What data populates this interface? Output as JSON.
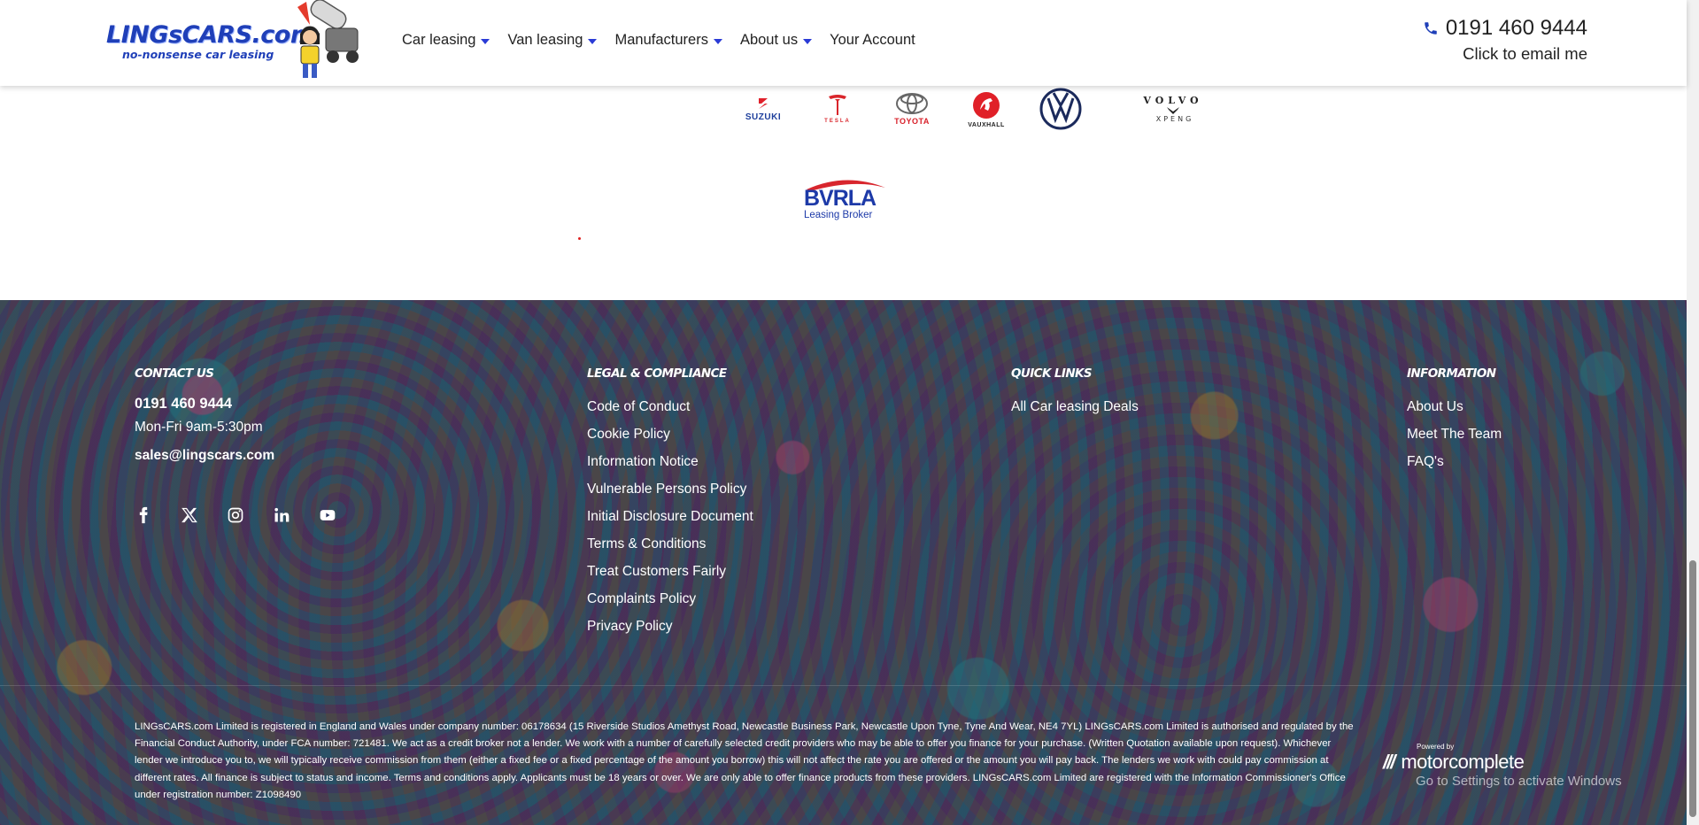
{
  "header": {
    "logo_text": "LINGsCARS.com",
    "logo_tagline": "no-nonsense car leasing",
    "nav": [
      {
        "label": "Car leasing",
        "has_dropdown": true
      },
      {
        "label": "Van leasing",
        "has_dropdown": true
      },
      {
        "label": "Manufacturers",
        "has_dropdown": true
      },
      {
        "label": "About us",
        "has_dropdown": true
      },
      {
        "label": "Your Account",
        "has_dropdown": false
      }
    ],
    "phone": "0191 460 9444",
    "email_cta": "Click to email me"
  },
  "brands": {
    "suzuki": "SUZUKI",
    "tesla": "TESLA",
    "toyota": "TOYOTA",
    "vauxhall": "VAUXHALL",
    "volvo": "VOLVO",
    "xpeng": "XPENG"
  },
  "bvrla": {
    "name": "BVRLA",
    "subtitle": "Leasing Broker"
  },
  "footer": {
    "contact": {
      "heading": "CONTACT US",
      "phone": "0191 460 9444",
      "hours": "Mon-Fri 9am-5:30pm",
      "email": "sales@lingscars.com",
      "socials": [
        "facebook-icon",
        "x-twitter-icon",
        "instagram-icon",
        "linkedin-icon",
        "youtube-icon"
      ]
    },
    "legal": {
      "heading": "LEGAL & COMPLIANCE",
      "links": [
        "Code of Conduct",
        "Cookie Policy",
        "Information Notice",
        "Vulnerable Persons Policy",
        "Initial Disclosure Document",
        "Terms & Conditions",
        "Treat Customers Fairly",
        "Complaints Policy",
        "Privacy Policy"
      ]
    },
    "quick": {
      "heading": "QUICK LINKS",
      "links": [
        "All Car leasing Deals"
      ]
    },
    "info": {
      "heading": "INFORMATION",
      "links": [
        "About Us",
        "Meet The Team",
        "FAQ's"
      ]
    },
    "legal_text": "LINGsCARS.com Limited is registered in England and Wales under company number: 06178634 (15 Riverside Studios Amethyst Road, Newcastle Business Park, Newcastle Upon Tyne, Tyne And Wear, NE4 7YL) LINGsCARS.com Limited is authorised and regulated by the Financial Conduct Authority, under FCA number: 721481. We act as a credit broker not a lender. We work with a number of carefully selected credit providers who may be able to offer you finance for your purchase. (Written Quotation available upon request). Whichever lender we introduce you to, we will typically receive commission from them (either a fixed fee or a fixed percentage of the amount you borrow) this will not affect the rate you are offered or the amount you will pay back. The lenders we work with could pay commission at different rates. All finance is subject to status and income. Terms and conditions apply. Applicants must be 18 years or over. We are only able to offer finance products from these providers. LINGsCARS.com Limited are registered with the Information Commissioner's Office under registration number: Z1098490",
    "powered_by": "Powered by",
    "powered_name": "motorcomplete"
  },
  "os_watermark": "Go to Settings to activate Windows",
  "colors": {
    "nav_caret": "#2a3bd6",
    "logo_blue": "#1f3fb8",
    "footer_bg": "#28355c"
  }
}
